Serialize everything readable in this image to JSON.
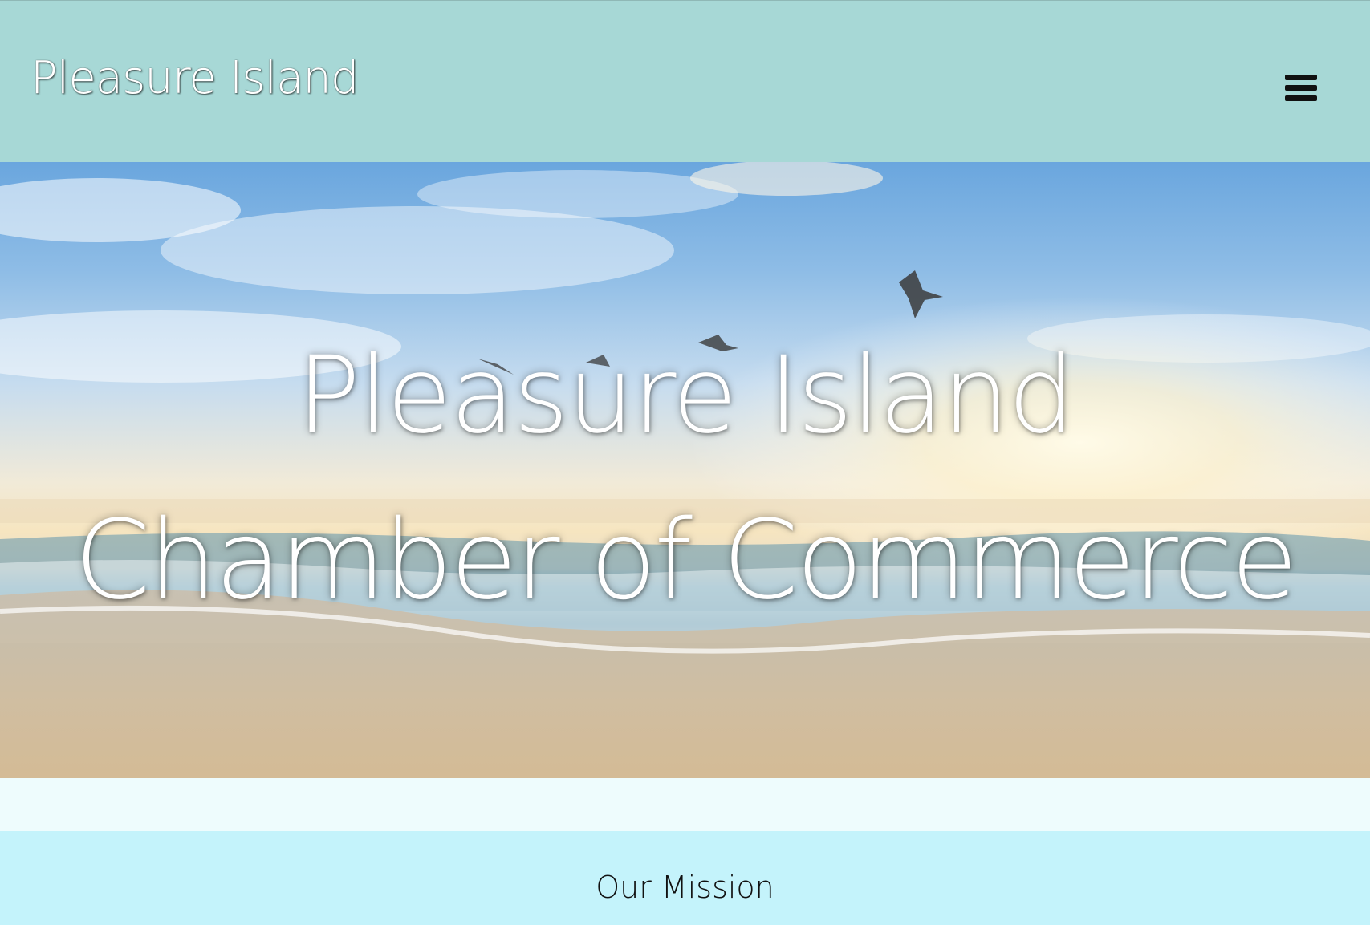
{
  "header": {
    "brand": "Pleasure Island",
    "menu_icon": "hamburger-menu-icon",
    "background_color": "#a7d8d6"
  },
  "hero": {
    "line1": "Pleasure Island",
    "line2": "Chamber of Commerce",
    "image": "beach-sunset-seagulls"
  },
  "mission": {
    "title": "Our Mission",
    "background_color": "#c4f3fb"
  }
}
